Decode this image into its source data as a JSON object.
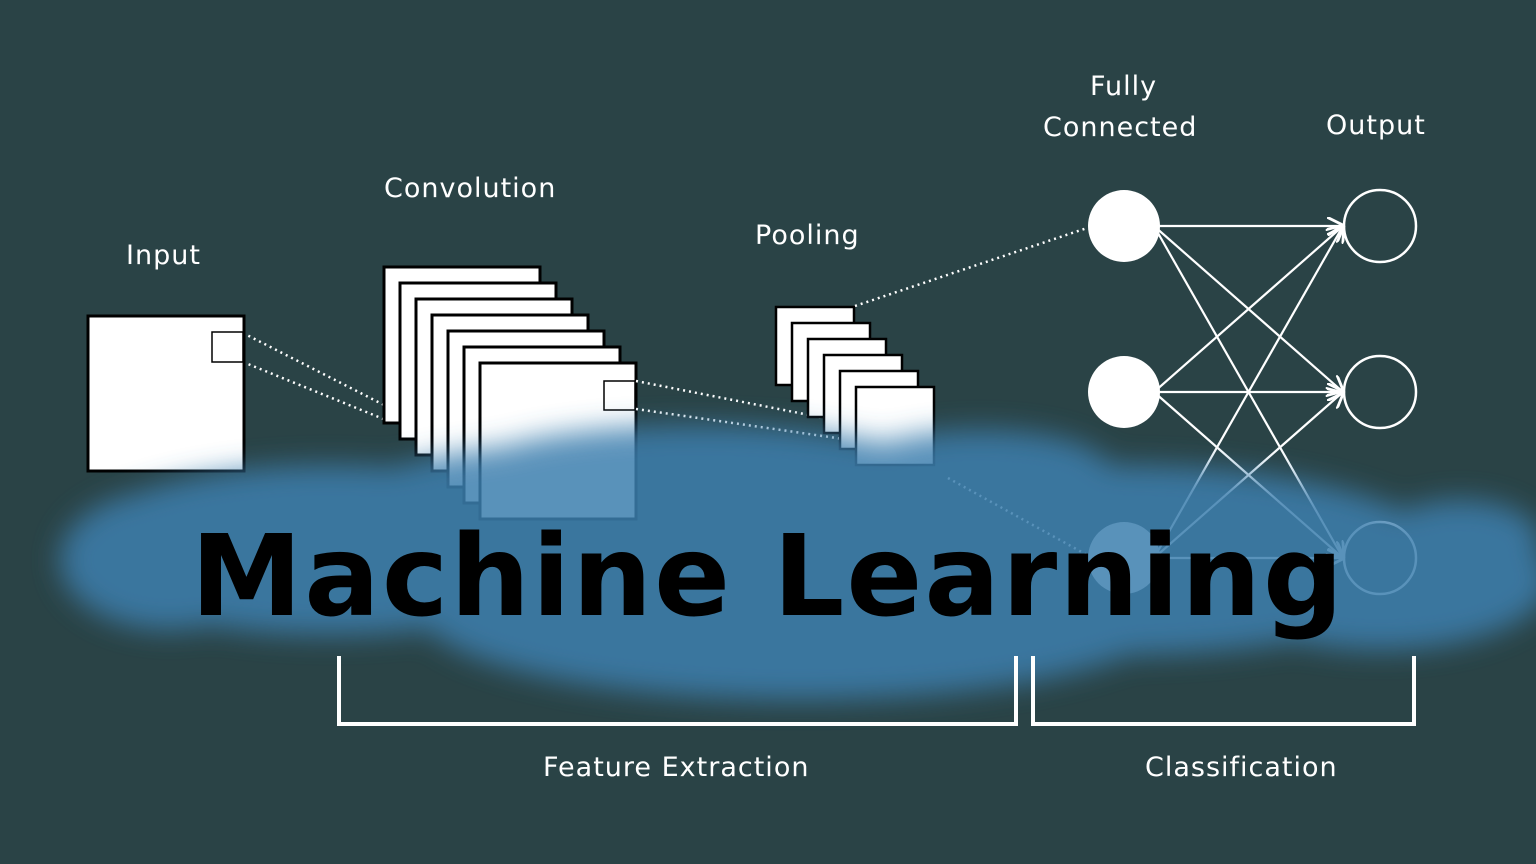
{
  "labels": {
    "input": "Input",
    "convolution": "Convolution",
    "pooling": "Pooling",
    "fully_connected_line1": "Fully",
    "fully_connected_line2": "Connected",
    "output": "Output",
    "feature_extraction": "Feature Extraction",
    "classification": "Classification"
  },
  "title": "Machine Learning",
  "colors": {
    "background": "#2a4346",
    "foreground": "#ffffff",
    "cloud": "#3d7fae",
    "title": "#000000"
  },
  "network": {
    "convolution_layers": 7,
    "pooling_layers": 6,
    "fully_connected_nodes": 3,
    "output_nodes": 3
  }
}
